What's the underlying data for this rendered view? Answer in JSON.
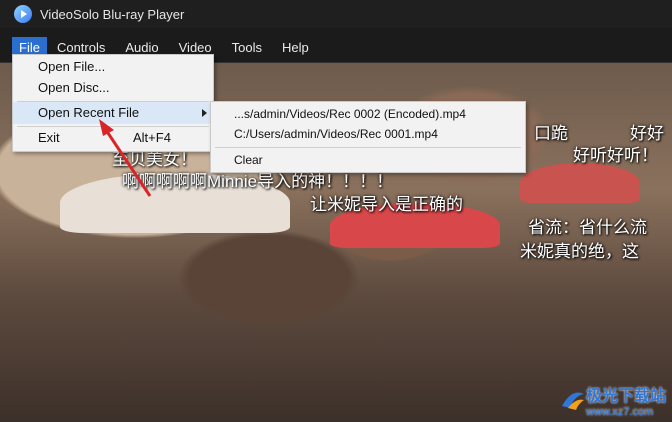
{
  "app": {
    "title": "VideoSolo Blu-ray Player"
  },
  "menubar": [
    "File",
    "Controls",
    "Audio",
    "Video",
    "Tools",
    "Help"
  ],
  "file_menu": {
    "open_file": "Open File...",
    "open_disc": "Open Disc...",
    "open_recent": "Open Recent File",
    "exit": "Exit",
    "exit_shortcut": "Alt+F4"
  },
  "recent_menu": {
    "item1": "...s/admin/Videos/Rec 0002 (Encoded).mp4",
    "item2": "C:/Users/admin/Videos/Rec 0001.mp4",
    "clear": "Clear"
  },
  "subtitles": {
    "l1": "啊啊啊啊啊Minnie导入的神！！！！",
    "l2": "让米妮导入是正确的",
    "l3": "至贝美女！",
    "r1": "口跪",
    "r2": "好好",
    "r3": "好听好听！",
    "r4": "省流：省什么流",
    "r5": "米妮真的绝，这"
  },
  "watermark": {
    "name": "极光下载站",
    "url": "www.xz7.com"
  },
  "colors": {
    "accent": "#2a6fd0",
    "menu_bg": "#f2f2f2",
    "arrow": "#d9242a"
  }
}
